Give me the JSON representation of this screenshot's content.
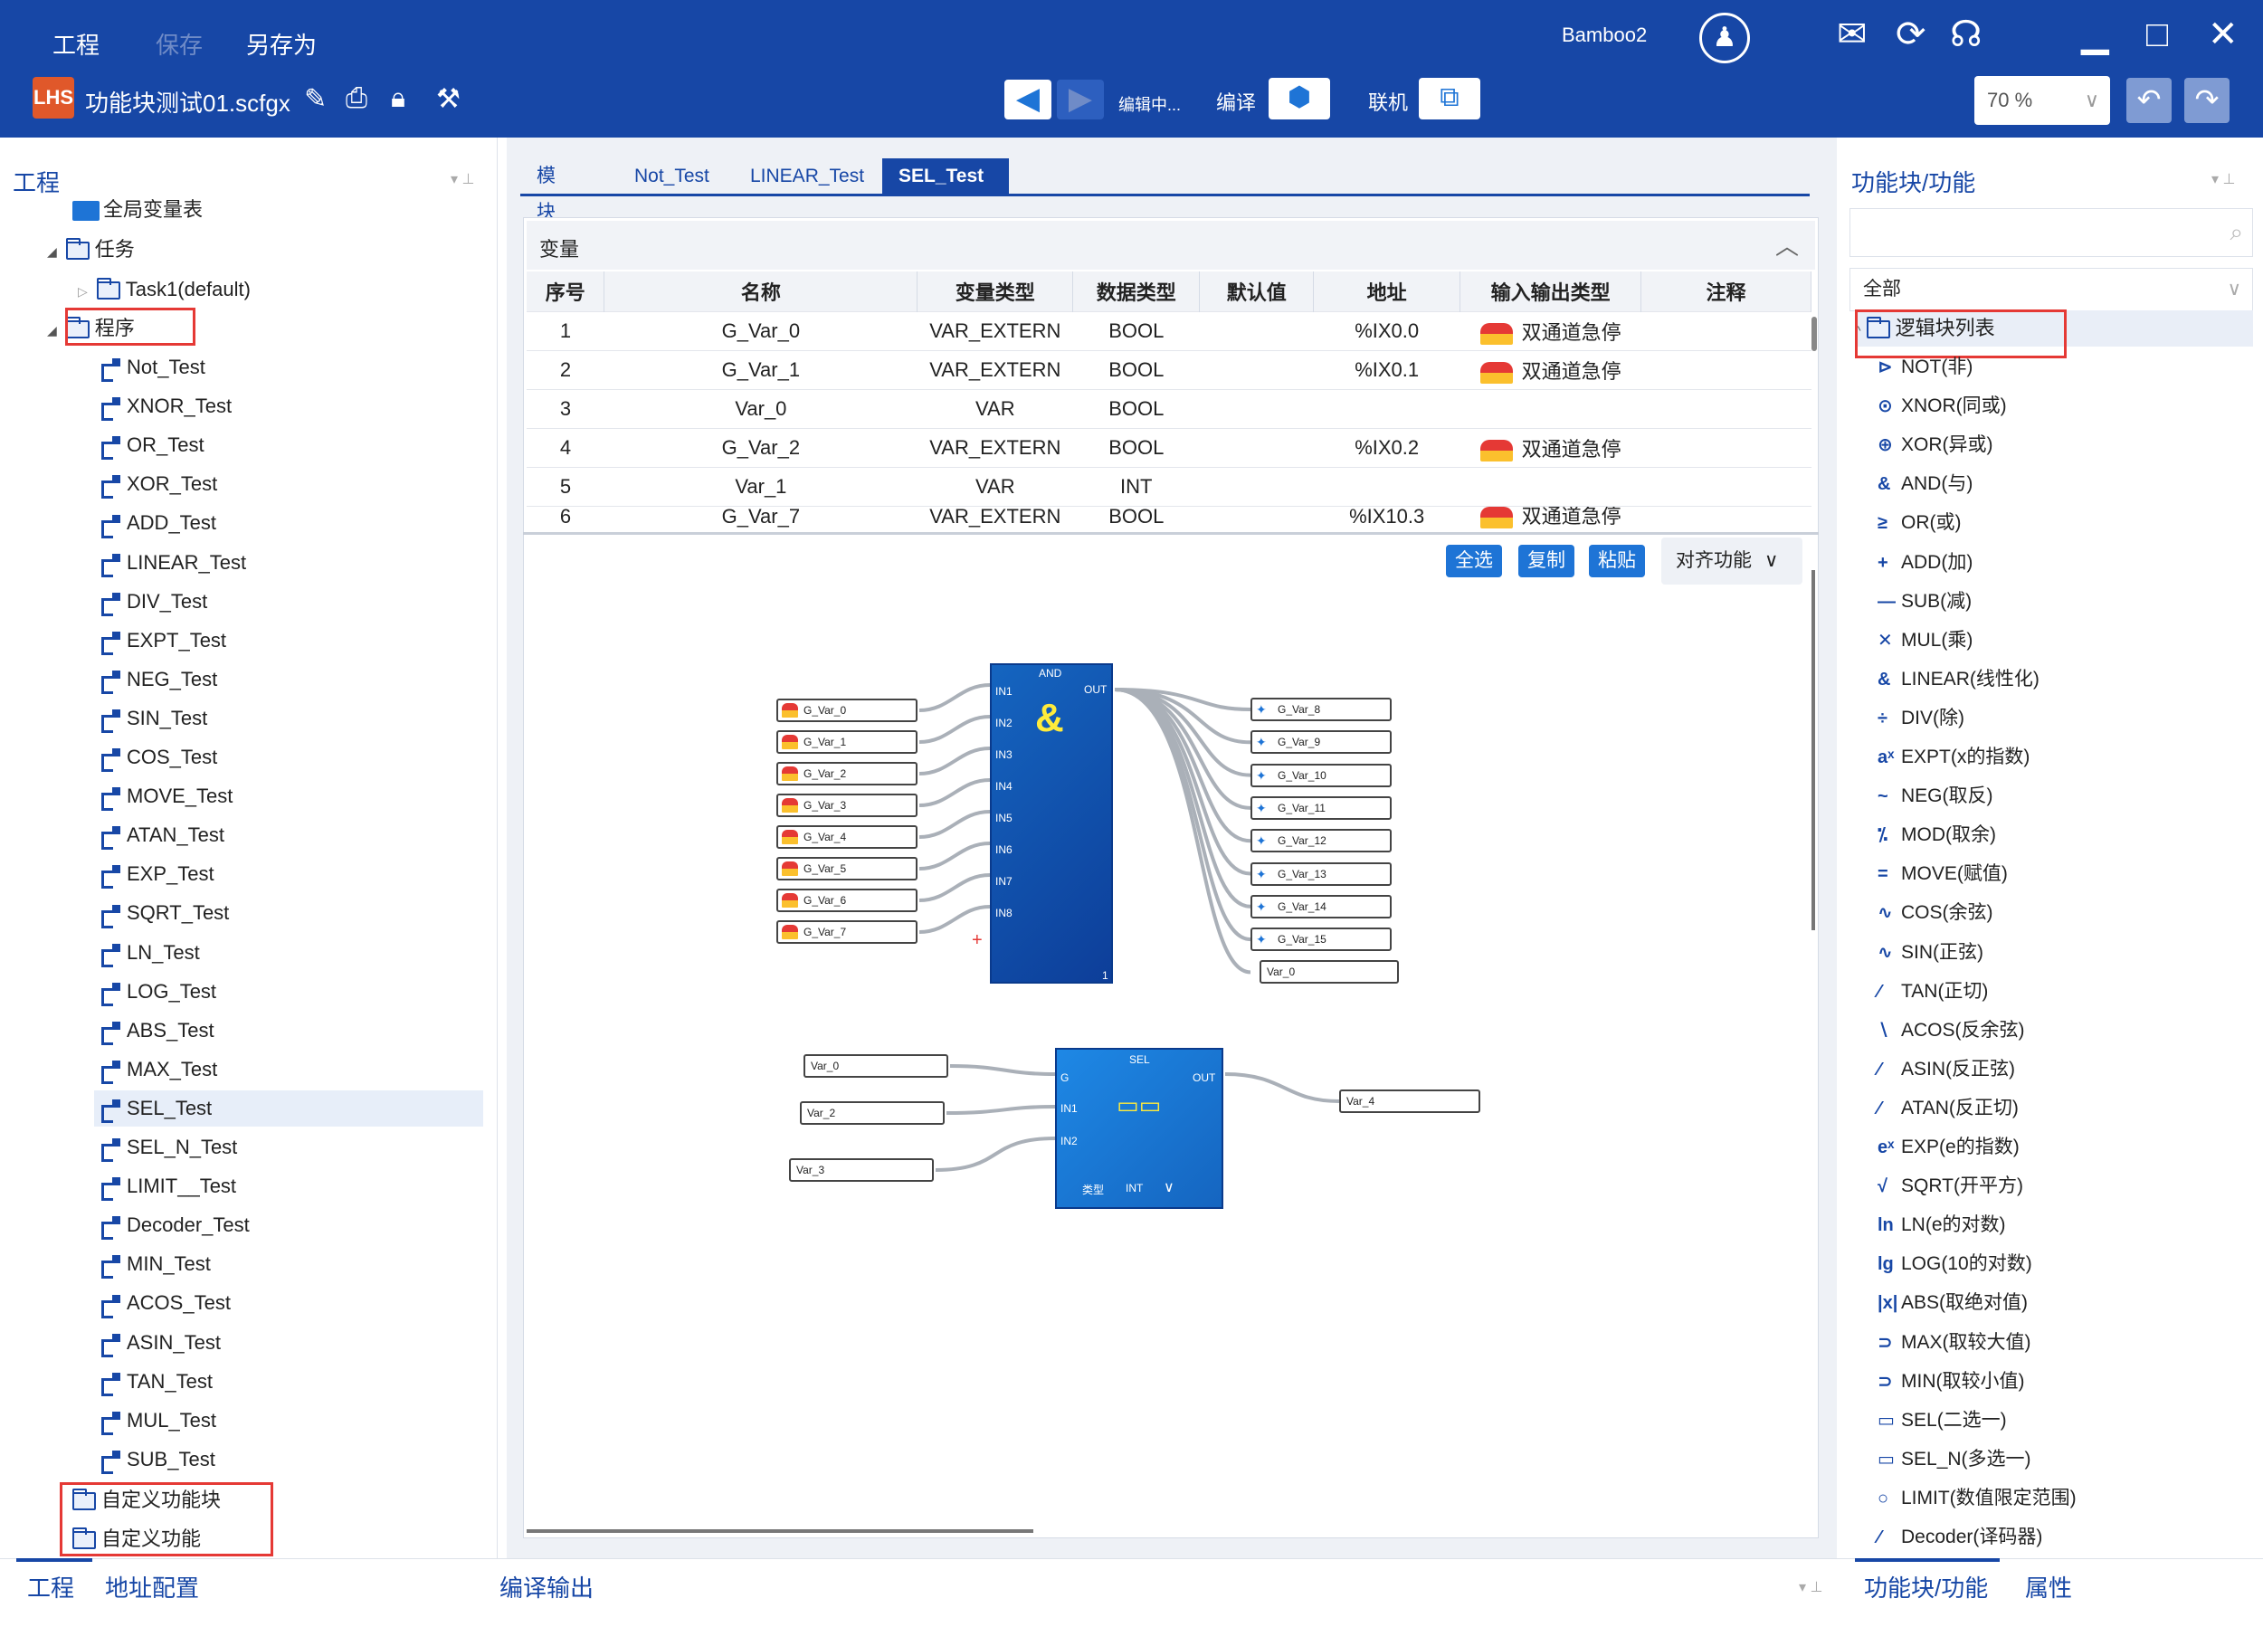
{
  "menu": {
    "project": "工程",
    "save": "保存",
    "save_as": "另存为"
  },
  "user": {
    "name": "Bamboo2"
  },
  "file": {
    "name": "功能块测试01.scfgx"
  },
  "toolbar": {
    "status": "编辑中...",
    "compile": "编译",
    "online": "联机",
    "zoom": "70 %"
  },
  "left_panel": {
    "title": "工程",
    "global_vars": "全局变量表",
    "tasks": "任务",
    "task1": "Task1(default)",
    "programs": "程序",
    "program_items": [
      "Not_Test",
      "XNOR_Test",
      "OR_Test",
      "XOR_Test",
      "ADD_Test",
      "LINEAR_Test",
      "DIV_Test",
      "EXPT_Test",
      "NEG_Test",
      "SIN_Test",
      "COS_Test",
      "MOVE_Test",
      "ATAN_Test",
      "EXP_Test",
      "SQRT_Test",
      "LN_Test",
      "LOG_Test",
      "ABS_Test",
      "MAX_Test",
      "SEL_Test",
      "SEL_N_Test",
      "LIMIT__Test",
      "Decoder_Test",
      "MIN_Test",
      "ACOS_Test",
      "ASIN_Test",
      "TAN_Test",
      "MUL_Test",
      "SUB_Test"
    ],
    "custom_fb": "自定义功能块",
    "custom_func": "自定义功能"
  },
  "tabs": [
    "模块视图",
    "Not_Test",
    "LINEAR_Test",
    "SEL_Test"
  ],
  "variables": {
    "title": "变量",
    "headers": [
      "序号",
      "名称",
      "变量类型",
      "数据类型",
      "默认值",
      "地址",
      "输入输出类型",
      "注释"
    ],
    "rows": [
      [
        "1",
        "G_Var_0",
        "VAR_EXTERN",
        "BOOL",
        "",
        "%IX0.0",
        "双通道急停",
        ""
      ],
      [
        "2",
        "G_Var_1",
        "VAR_EXTERN",
        "BOOL",
        "",
        "%IX0.1",
        "双通道急停",
        ""
      ],
      [
        "3",
        "Var_0",
        "VAR",
        "BOOL",
        "",
        "",
        "",
        ""
      ],
      [
        "4",
        "G_Var_2",
        "VAR_EXTERN",
        "BOOL",
        "",
        "%IX0.2",
        "双通道急停",
        ""
      ],
      [
        "5",
        "Var_1",
        "VAR",
        "INT",
        "",
        "",
        "",
        ""
      ],
      [
        "6",
        "G_Var_7",
        "VAR_EXTERN",
        "BOOL",
        "",
        "%IX10.3",
        "双通道急停",
        ""
      ]
    ]
  },
  "canvas_buttons": {
    "select_all": "全选",
    "copy": "复制",
    "paste": "粘贴",
    "align": "对齐功能"
  },
  "and_block": {
    "title": "AND",
    "symbol": "&",
    "out": "OUT",
    "footer": "1",
    "inputs": [
      "IN1",
      "IN2",
      "IN3",
      "IN4",
      "IN5",
      "IN6",
      "IN7",
      "IN8"
    ],
    "input_vars": [
      "G_Var_0",
      "G_Var_1",
      "G_Var_2",
      "G_Var_3",
      "G_Var_4",
      "G_Var_5",
      "G_Var_6",
      "G_Var_7"
    ],
    "output_vars": [
      "G_Var_8",
      "G_Var_9",
      "G_Var_10",
      "G_Var_11",
      "G_Var_12",
      "G_Var_13",
      "G_Var_14",
      "G_Var_15",
      "Var_0"
    ]
  },
  "sel_block": {
    "title": "SEL",
    "out": "OUT",
    "type_label": "类型",
    "type_value": "INT",
    "inputs": [
      "G",
      "IN1",
      "IN2"
    ],
    "input_vars": [
      "Var_0",
      "Var_2",
      "Var_3"
    ],
    "output_var": "Var_4"
  },
  "right_panel": {
    "title": "功能块/功能",
    "filter": "全部",
    "category": "逻辑块列表",
    "items": [
      "NOT(非)",
      "XNOR(同或)",
      "XOR(异或)",
      "AND(与)",
      "OR(或)",
      "ADD(加)",
      "SUB(减)",
      "MUL(乘)",
      "LINEAR(线性化)",
      "DIV(除)",
      "EXPT(x的指数)",
      "NEG(取反)",
      "MOD(取余)",
      "MOVE(赋值)",
      "COS(余弦)",
      "SIN(正弦)",
      "TAN(正切)",
      "ACOS(反余弦)",
      "ASIN(反正弦)",
      "ATAN(反正切)",
      "EXP(e的指数)",
      "SQRT(开平方)",
      "LN(e的对数)",
      "LOG(10的对数)",
      "ABS(取绝对值)",
      "MAX(取较大值)",
      "MIN(取较小值)",
      "SEL(二选一)",
      "SEL_N(多选一)",
      "LIMIT(数值限定范围)",
      "Decoder(译码器)"
    ],
    "icons": [
      "⊳",
      "⊙",
      "⊕",
      "&",
      "≥",
      "+",
      "—",
      "✕",
      "&",
      "÷",
      "aˣ",
      "~",
      "⁒",
      "=",
      "∿",
      "∿",
      "⁄",
      "∖",
      "⁄",
      "⁄",
      "eˣ",
      "√",
      "ln",
      "lg",
      "|x|",
      "⊃",
      "⊃",
      "▭",
      "▭",
      "○",
      "⁄"
    ]
  },
  "bottom": {
    "left_tab1": "工程",
    "left_tab2": "地址配置",
    "middle": "编译输出",
    "right_tab1": "功能块/功能",
    "right_tab2": "属性"
  }
}
